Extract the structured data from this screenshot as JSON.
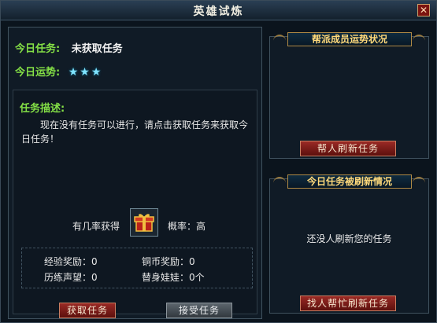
{
  "window": {
    "title": "英雄试炼",
    "close_label": "✕"
  },
  "left": {
    "task_label": "今日任务:",
    "task_value": "未获取任务",
    "fortune_label": "今日运势:",
    "fortune_stars": 3,
    "description_title": "任务描述:",
    "description_text": "现在没有任务可以进行，请点击获取任务来获取今日任务！",
    "reward_prefix": "有几率获得",
    "probability": "概率：高",
    "rewards": {
      "exp": "经验奖励：0",
      "copper": "铜币奖励：0",
      "prestige": "历练声望：0",
      "doll": "替身娃娃：0个"
    },
    "buttons": {
      "get_task": "获取任务",
      "accept_task": "接受任务"
    }
  },
  "right_top": {
    "title": "帮派成员运势状况",
    "button": "帮人刷新任务"
  },
  "right_bottom": {
    "title": "今日任务被刷新情况",
    "note": "还没人刷新您的任务",
    "button": "找人帮忙刷新任务"
  },
  "colors": {
    "accent_green": "#84e046",
    "gold": "#ffd97a",
    "star": "#7fe3ff",
    "button_red": "#7c1a16"
  }
}
